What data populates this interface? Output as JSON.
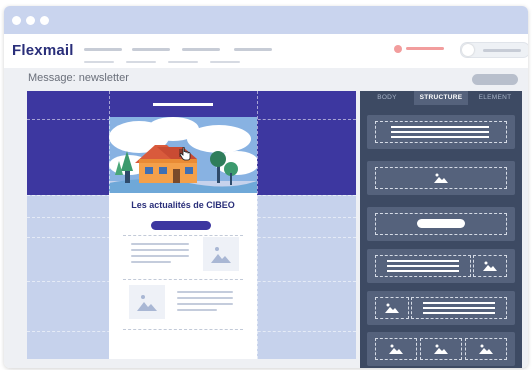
{
  "app": {
    "logo": "Flexmail"
  },
  "page": {
    "title": "Message: newsletter"
  },
  "email": {
    "headline": "Les actualités de CIBEO"
  },
  "panel": {
    "tabs": [
      "BODY",
      "STRUCTURE",
      "ELEMENT"
    ],
    "active_tab": "STRUCTURE"
  },
  "colors": {
    "brand": "#3d37a0",
    "panel": "#3d4a63",
    "accent": "#f29d9d",
    "titlebar": "#c9d4ee"
  },
  "icons": [
    "cursor-hand-icon",
    "image-placeholder-icon"
  ]
}
